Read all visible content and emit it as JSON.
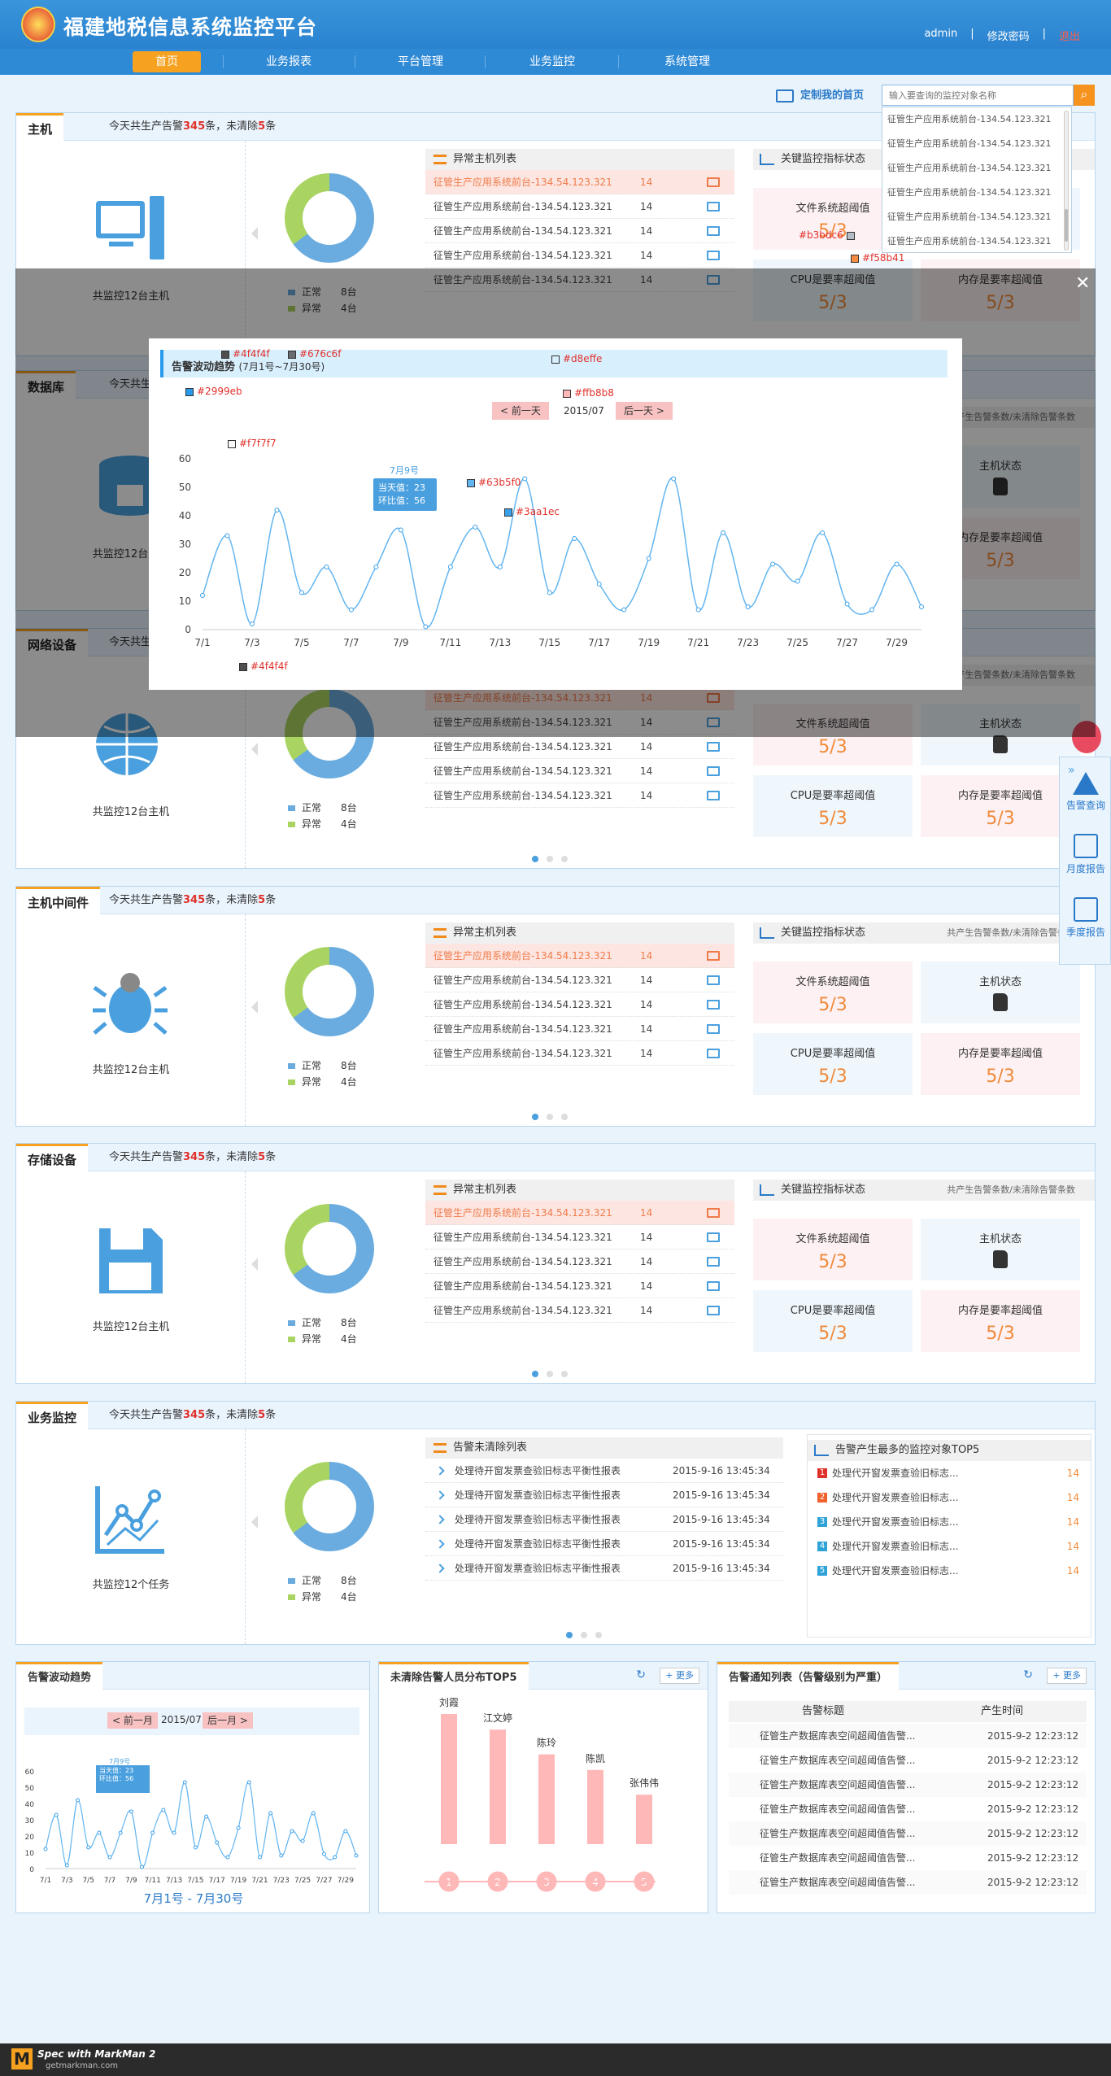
{
  "app": {
    "title": "福建地税信息系统监控平台",
    "user": "admin",
    "change_pwd": "修改密码",
    "logout": "退出"
  },
  "nav": [
    "首页",
    "业务报表",
    "平台管理",
    "业务监控",
    "系统管理"
  ],
  "toolbar": {
    "custom_home": "定制我的首页",
    "search_placeholder": "输入要查询的监控对象名称"
  },
  "suggestions": [
    "征管生产应用系统前台-134.54.123.321",
    "征管生产应用系统前台-134.54.123.321",
    "征管生产应用系统前台-134.54.123.321",
    "征管生产应用系统前台-134.54.123.321",
    "征管生产应用系统前台-134.54.123.321",
    "征管生产应用系统前台-134.54.123.321"
  ],
  "summary": {
    "prefix": "今天共生产告警",
    "alerts": "345",
    "mid": "条，未清除",
    "uncleared": "5",
    "suffix": "条"
  },
  "panels": [
    {
      "title": "主机",
      "host_label": "共监控12台主机",
      "list_title": "异常主机列表",
      "kpi_title": "关键监控指标状态",
      "kpi_sub": ""
    },
    {
      "title": "数据库",
      "host_label": "共监控12台主机",
      "list_title": "异常主机列表",
      "kpi_title": "关键监控指标状态",
      "kpi_sub": "共产生告警条数/未清除告警条数"
    },
    {
      "title": "网络设备",
      "host_label": "共监控12台主机",
      "list_title": "异常主机列表",
      "kpi_title": "关键监控指标状态",
      "kpi_sub": "共产生告警条数/未清除告警条数"
    },
    {
      "title": "主机中间件",
      "host_label": "共监控12台主机",
      "list_title": "异常主机列表",
      "kpi_title": "关键监控指标状态",
      "kpi_sub": "共产生告警条数/未清除告警条数"
    },
    {
      "title": "存储设备",
      "host_label": "共监控12台主机",
      "list_title": "异常主机列表",
      "kpi_title": "关键监控指标状态",
      "kpi_sub": "共产生告警条数/未清除告警条数"
    }
  ],
  "legend": {
    "normal": "正常",
    "normal_count": "8台",
    "abnormal": "异常",
    "abnormal_count": "4台"
  },
  "host_rows": [
    {
      "name": "征管生产应用系统前台-134.54.123.321",
      "count": "14"
    },
    {
      "name": "征管生产应用系统前台-134.54.123.321",
      "count": "14"
    },
    {
      "name": "征管生产应用系统前台-134.54.123.321",
      "count": "14"
    },
    {
      "name": "征管生产应用系统前台-134.54.123.321",
      "count": "14"
    },
    {
      "name": "征管生产应用系统前台-134.54.123.321",
      "count": "14"
    }
  ],
  "kpis": {
    "fs": "文件系统超阈值",
    "fs_val": "5/3",
    "host": "主机状态",
    "cpu": "CPU是要率超阈值",
    "cpu_val": "5/3",
    "mem": "内存是要率超阈值",
    "mem_val": "5/3"
  },
  "biz": {
    "title": "业务监控",
    "host_label": "共监控12个任务",
    "list_title": "告警未清除列表",
    "top_title": "告警产生最多的监控对象TOP5"
  },
  "tasks": [
    {
      "name": "处理待开窗发票查验旧标志平衡性报表",
      "time": "2015-9-16 13:45:34"
    },
    {
      "name": "处理待开窗发票查验旧标志平衡性报表",
      "time": "2015-9-16 13:45:34"
    },
    {
      "name": "处理待开窗发票查验旧标志平衡性报表",
      "time": "2015-9-16 13:45:34"
    },
    {
      "name": "处理待开窗发票查验旧标志平衡性报表",
      "time": "2015-9-16 13:45:34"
    },
    {
      "name": "处理待开窗发票查验旧标志平衡性报表",
      "time": "2015-9-16 13:45:34"
    }
  ],
  "top5": [
    {
      "rank": "1",
      "name": "处理代开窗发票查验旧标志...",
      "count": "14",
      "color": "#e0302a"
    },
    {
      "rank": "2",
      "name": "处理代开窗发票查验旧标志...",
      "count": "14",
      "color": "#f0602a"
    },
    {
      "rank": "3",
      "name": "处理代开窗发票查验旧标志...",
      "count": "14",
      "color": "#2fa3d8"
    },
    {
      "rank": "4",
      "name": "处理代开窗发票查验旧标志...",
      "count": "14",
      "color": "#2fa3d8"
    },
    {
      "rank": "5",
      "name": "处理代开窗发票查验旧标志...",
      "count": "14",
      "color": "#2fa3d8"
    }
  ],
  "widgets": {
    "trend_title": "告警波动趋势",
    "prev_month": "< 前一月",
    "month": "2015/07",
    "next_month": "后一月 >",
    "range": "7月1号 - 7月30号",
    "staff_title": "未清除告警人员分布TOP5",
    "more": "+ 更多",
    "notice_title": "告警通知列表（告警级别为严重）",
    "col_title": "告警标题",
    "col_time": "产生时间"
  },
  "notices": [
    {
      "title": "征管生产数据库表空间超阈值告警...",
      "time": "2015-9-2   12:23:12"
    },
    {
      "title": "征管生产数据库表空间超阈值告警...",
      "time": "2015-9-2   12:23:12"
    },
    {
      "title": "征管生产数据库表空间超阈值告警...",
      "time": "2015-9-2   12:23:12"
    },
    {
      "title": "征管生产数据库表空间超阈值告警...",
      "time": "2015-9-2   12:23:12"
    },
    {
      "title": "征管生产数据库表空间超阈值告警...",
      "time": "2015-9-2   12:23:12"
    },
    {
      "title": "征管生产数据库表空间超阈值告警...",
      "time": "2015-9-2   12:23:12"
    },
    {
      "title": "征管生产数据库表空间超阈值告警...",
      "time": "2015-9-2   12:23:12"
    }
  ],
  "modal": {
    "title": "告警波动趋势",
    "subtitle": "(7月1号~7月30号)",
    "prev": "< 前一天",
    "date": "2015/07",
    "next": "后一天 >",
    "tip_day": "7月9号",
    "tip_cur": "当天值：23",
    "tip_ring": "环比值：56"
  },
  "mini_tip": {
    "day": "7月9号",
    "cur": "当天值：23",
    "ring": "环比值：56"
  },
  "annotations": {
    "c1": "#2999eb",
    "c2": "#4f4f4f",
    "c3": "#676c6f",
    "c4": "#d8effe",
    "c5": "#ffb8b8",
    "c6": "#f7f7f7",
    "c7": "#63b5f0",
    "c8": "#3aa1ec",
    "c9": "#4f4f4f",
    "c10": "#b3bdc6",
    "c11": "#f58b41"
  },
  "float_bar": [
    "告警查询",
    "月度报告",
    "季度报告"
  ],
  "footer": {
    "brand": "Spec with MarkMan 2",
    "url": "getmarkman.com"
  },
  "chart_data": [
    {
      "type": "line",
      "title": "告警波动趋势",
      "x": [
        "7/1",
        "7/2",
        "7/3",
        "7/4",
        "7/5",
        "7/6",
        "7/7",
        "7/8",
        "7/9",
        "7/10",
        "7/11",
        "7/12",
        "7/13",
        "7/14",
        "7/15",
        "7/16",
        "7/17",
        "7/18",
        "7/19",
        "7/20",
        "7/21",
        "7/22",
        "7/23",
        "7/24",
        "7/25",
        "7/26",
        "7/27",
        "7/28",
        "7/29",
        "7/30"
      ],
      "xticks": [
        "7/1",
        "7/3",
        "7/5",
        "7/7",
        "7/9",
        "7/11",
        "7/13",
        "7/15",
        "7/17",
        "7/19",
        "7/21",
        "7/23",
        "7/25",
        "7/27",
        "7/29"
      ],
      "values": [
        12,
        33,
        2,
        42,
        13,
        22,
        7,
        22,
        35,
        1,
        22,
        36,
        22,
        53,
        13,
        32,
        16,
        7,
        25,
        53,
        7,
        34,
        8,
        23,
        17,
        34,
        9,
        7,
        23,
        8
      ],
      "ylim": [
        0,
        60
      ],
      "yticks": [
        0,
        10,
        20,
        30,
        40,
        50,
        60
      ]
    },
    {
      "type": "bar",
      "title": "未清除告警人员分布TOP5",
      "categories": [
        "刘霞",
        "江文婷",
        "陈玲",
        "陈凯",
        "张伟伟"
      ],
      "values": [
        100,
        88,
        69,
        57,
        38
      ],
      "ranks": [
        "1",
        "2",
        "3",
        "4",
        "5"
      ]
    }
  ]
}
